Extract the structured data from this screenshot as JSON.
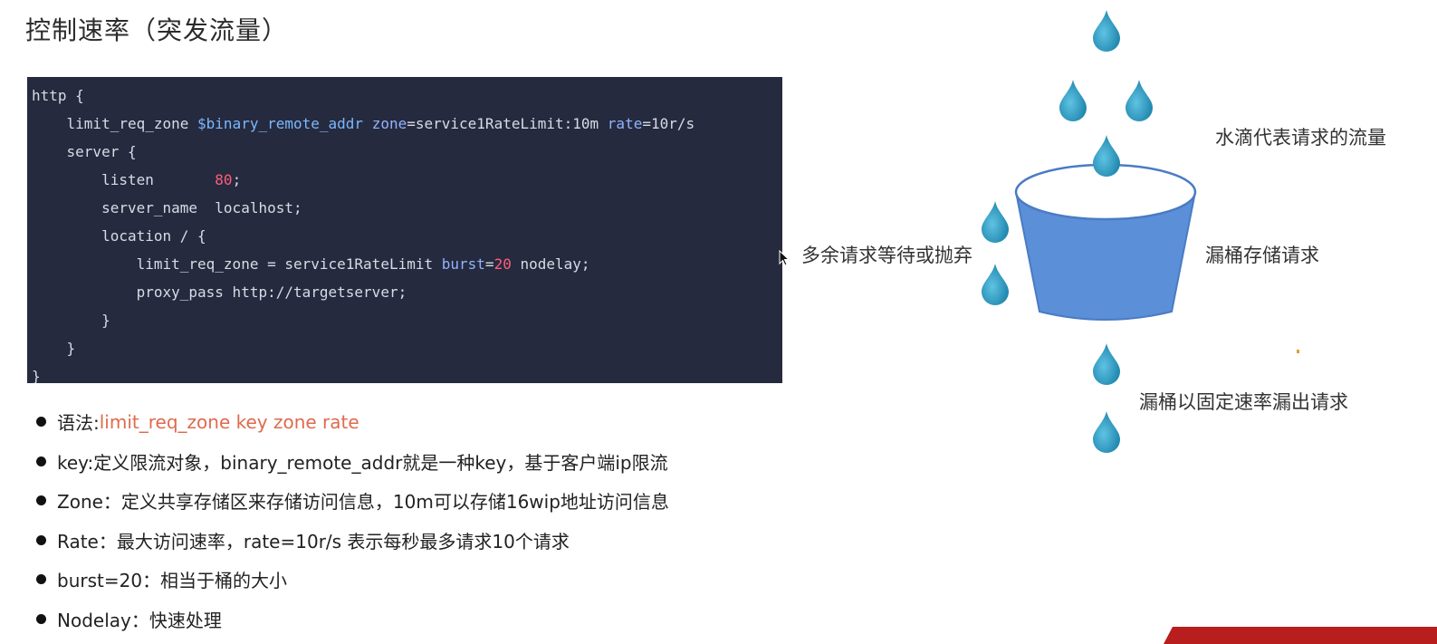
{
  "title": "控制速率（突发流量）",
  "code": {
    "lines": [
      [
        {
          "t": "http {",
          "c": "plain"
        }
      ],
      [
        {
          "t": "    limit_req_zone ",
          "c": "plain"
        },
        {
          "t": "$binary_remote_addr",
          "c": "var"
        },
        {
          "t": " ",
          "c": "plain"
        },
        {
          "t": "zone",
          "c": "key"
        },
        {
          "t": "=service1RateLimit:10m ",
          "c": "plain"
        },
        {
          "t": "rate",
          "c": "key"
        },
        {
          "t": "=10r/s",
          "c": "plain"
        }
      ],
      [
        {
          "t": "    server {",
          "c": "plain"
        }
      ],
      [
        {
          "t": "        listen       ",
          "c": "plain"
        },
        {
          "t": "80",
          "c": "num"
        },
        {
          "t": ";",
          "c": "plain"
        }
      ],
      [
        {
          "t": "        server_name  localhost;",
          "c": "plain"
        }
      ],
      [
        {
          "t": "        location / {",
          "c": "plain"
        }
      ],
      [
        {
          "t": "            limit_req_zone = service1RateLimit ",
          "c": "plain"
        },
        {
          "t": "burst",
          "c": "key"
        },
        {
          "t": "=",
          "c": "plain"
        },
        {
          "t": "20",
          "c": "num"
        },
        {
          "t": " nodelay;",
          "c": "plain"
        }
      ],
      [
        {
          "t": "            proxy_pass http://targetserver;",
          "c": "plain"
        }
      ],
      [
        {
          "t": "        }",
          "c": "plain"
        }
      ],
      [
        {
          "t": "    }",
          "c": "plain"
        }
      ],
      [
        {
          "t": "}",
          "c": "plain"
        }
      ]
    ]
  },
  "bullets": {
    "syntax_label": "语法: ",
    "syntax_value": "limit_req_zone key zone rate",
    "items": [
      "key:定义限流对象，binary_remote_addr就是一种key，基于客户端ip限流",
      "Zone：定义共享存储区来存储访问信息，10m可以存储16wip地址访问信息",
      "Rate：最大访问速率，rate=10r/s  表示每秒最多请求10个请求",
      "burst=20：相当于桶的大小",
      "Nodelay：快速处理"
    ]
  },
  "diagram": {
    "label_water": "水滴代表请求的流量",
    "label_bucket": "漏桶存储请求",
    "label_overflow": "多余请求等待或抛弃",
    "label_leak": "漏桶以固定速率漏出请求"
  },
  "colors": {
    "code_bg": "#262a3e",
    "drop": "#2e9ec4",
    "bucket": "#5b8fd8",
    "syntax_accent": "#e06a4e"
  },
  "icons": {
    "drop": "water-drop-icon",
    "cursor": "mouse-cursor-icon"
  }
}
